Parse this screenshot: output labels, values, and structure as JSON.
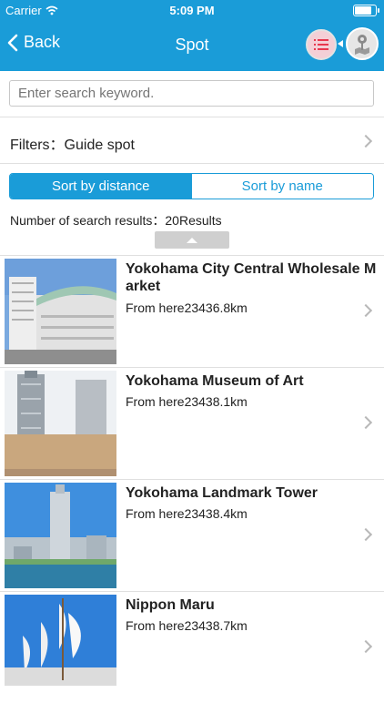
{
  "status_bar": {
    "carrier": "Carrier",
    "time": "5:09 PM",
    "battery_level": 0.9
  },
  "nav": {
    "back_label": "Back",
    "title": "Spot"
  },
  "search": {
    "placeholder": "Enter search keyword.",
    "value": ""
  },
  "filter": {
    "label": "Filters：Guide spot"
  },
  "sort": {
    "by_distance": "Sort by distance",
    "by_name": "Sort by name",
    "active": "by_distance"
  },
  "results": {
    "count_text": "Number of search results：20Results"
  },
  "spots": [
    {
      "name": "Yokohama City Central Wholesale Market",
      "distance": "From here23436.8km"
    },
    {
      "name": "Yokohama Museum of Art",
      "distance": "From here23438.1km"
    },
    {
      "name": "Yokohama Landmark Tower",
      "distance": "From here23438.4km"
    },
    {
      "name": "Nippon Maru",
      "distance": "From here23438.7km"
    }
  ],
  "colors": {
    "accent": "#1a9cd8",
    "list_button": "#f4cfd6",
    "separator": "#e0e0e0"
  },
  "icons": {
    "back": "chevron-left-icon",
    "list": "list-icon",
    "map": "map-pin-icon",
    "row": "chevron-right-icon"
  }
}
